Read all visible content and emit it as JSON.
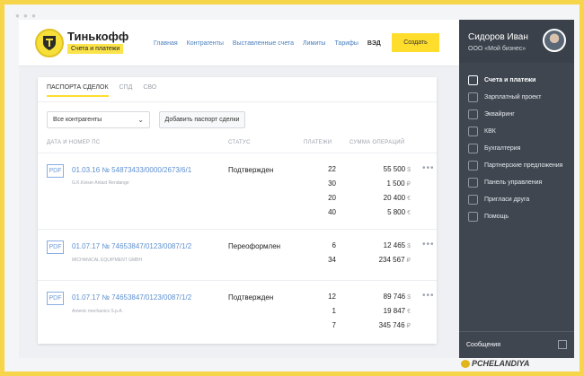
{
  "brand": {
    "name": "Тинькофф",
    "subtitle": "Счета и платежи"
  },
  "nav": {
    "items": [
      "Главная",
      "Контрагенты",
      "Выставленные счета",
      "Лимиты",
      "Тарифы"
    ],
    "ved": "ВЭД",
    "create_label": "Создать"
  },
  "profile": {
    "name": "Сидоров Иван",
    "org": "ООО «Мой бизнес»"
  },
  "sidebar": {
    "items": [
      {
        "label": "Счета и платежи",
        "icon": "accounts-icon"
      },
      {
        "label": "Зарплатный проект",
        "icon": "payroll-icon"
      },
      {
        "label": "Эквайринг",
        "icon": "cart-icon"
      },
      {
        "label": "КВК",
        "icon": "check-icon"
      },
      {
        "label": "Бухгалтерия",
        "icon": "accounting-icon"
      },
      {
        "label": "Партнерские предложения",
        "icon": "star-icon"
      },
      {
        "label": "Панель управления",
        "icon": "gear-icon"
      },
      {
        "label": "Пригласи друга",
        "icon": "gift-icon"
      },
      {
        "label": "Помощь",
        "icon": "book-icon"
      }
    ],
    "messages_label": "Сообщения"
  },
  "tabs": [
    "ПАСПОРТА СДЕЛОК",
    "СПД",
    "СВО"
  ],
  "filter": {
    "selected": "Все контрагенты",
    "add_label": "Добавить паспорт сделки"
  },
  "columns": {
    "date_no": "ДАТА И НОМЕР ПС",
    "status": "СТАТУС",
    "payments": "ПЛАТЕЖИ",
    "sum": "СУММА ОПЕРАЦИЙ"
  },
  "rows": [
    {
      "pdf": "PDF",
      "date_no": "01.03.16  № 54873433/0000/2673/6/1",
      "company": "G.K.Keiser Anlast Rendange",
      "status": "Подтвержден",
      "payments": [
        "22",
        "30",
        "20",
        "40"
      ],
      "sums": [
        {
          "amount": "55 500",
          "currency": "$"
        },
        {
          "amount": "1 500",
          "currency": "₽"
        },
        {
          "amount": "20 400",
          "currency": "€"
        },
        {
          "amount": "5 800",
          "currency": "€"
        }
      ]
    },
    {
      "pdf": "PDF",
      "date_no": "01.07.17  № 74653847/0123/0087/1/2",
      "company": "MICHANICAL EQUIPMENT GMBH",
      "status": "Переоформлен",
      "payments": [
        "6",
        "34"
      ],
      "sums": [
        {
          "amount": "12 465",
          "currency": "$"
        },
        {
          "amount": "234 567",
          "currency": "₽"
        }
      ]
    },
    {
      "pdf": "PDF",
      "date_no": "01.07.17  № 74653847/0123/0087/1/2",
      "company": "Ameniс mechanics S.p.A.",
      "status": "Подтвержден",
      "payments": [
        "12",
        "1",
        "7"
      ],
      "sums": [
        {
          "amount": "89 746",
          "currency": "$"
        },
        {
          "amount": "19 847",
          "currency": "€"
        },
        {
          "amount": "345 746",
          "currency": "₽"
        }
      ]
    }
  ],
  "more_glyph": "•••",
  "watermark": "PCHELANDIYA"
}
